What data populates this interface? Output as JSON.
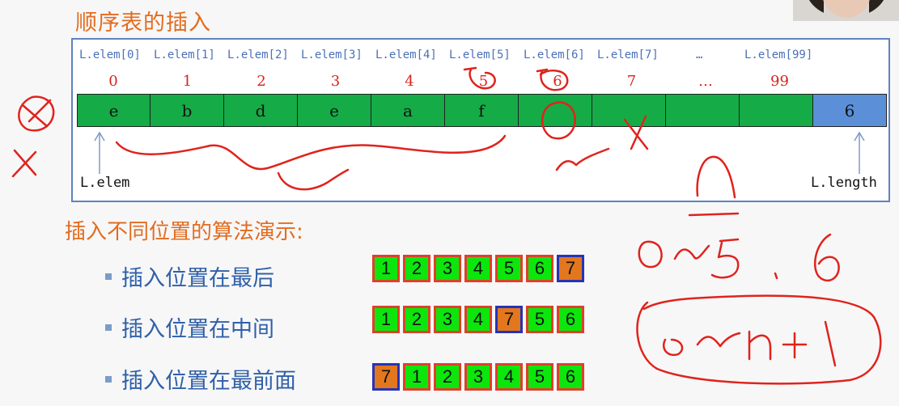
{
  "title": "顺序表的插入",
  "elem_labels": [
    "L.elem[0]",
    "L.elem[1]",
    "L.elem[2]",
    "L.elem[3]",
    "L.elem[4]",
    "L.elem[5]",
    "L.elem[6]",
    "L.elem[7]",
    "…",
    "L.elem[99]"
  ],
  "indices": [
    "0",
    "1",
    "2",
    "3",
    "4",
    "5",
    "6",
    "7",
    "…",
    "99"
  ],
  "cells": [
    "e",
    "b",
    "d",
    "e",
    "a",
    "f",
    "",
    "",
    "",
    "",
    "6"
  ],
  "pointer_elem": "L.elem",
  "pointer_length": "L.length",
  "subtitle": "插入不同位置的算法演示:",
  "demos": [
    {
      "label": "插入位置在最后",
      "values": [
        "1",
        "2",
        "3",
        "4",
        "5",
        "6",
        "7"
      ],
      "inserted_index": 6
    },
    {
      "label": "插入位置在中间",
      "values": [
        "1",
        "2",
        "3",
        "4",
        "7",
        "5",
        "6"
      ],
      "inserted_index": 4
    },
    {
      "label": "插入位置在最前面",
      "values": [
        "7",
        "1",
        "2",
        "3",
        "4",
        "5",
        "6"
      ],
      "inserted_index": 0
    }
  ],
  "colors": {
    "title": "#e36c1f",
    "array_cell": "#15ab46",
    "length_cell": "#5b8fd8",
    "demo_cell": "#0ce60c",
    "demo_inserted": "#e2771d",
    "ink": "#e0231c"
  }
}
